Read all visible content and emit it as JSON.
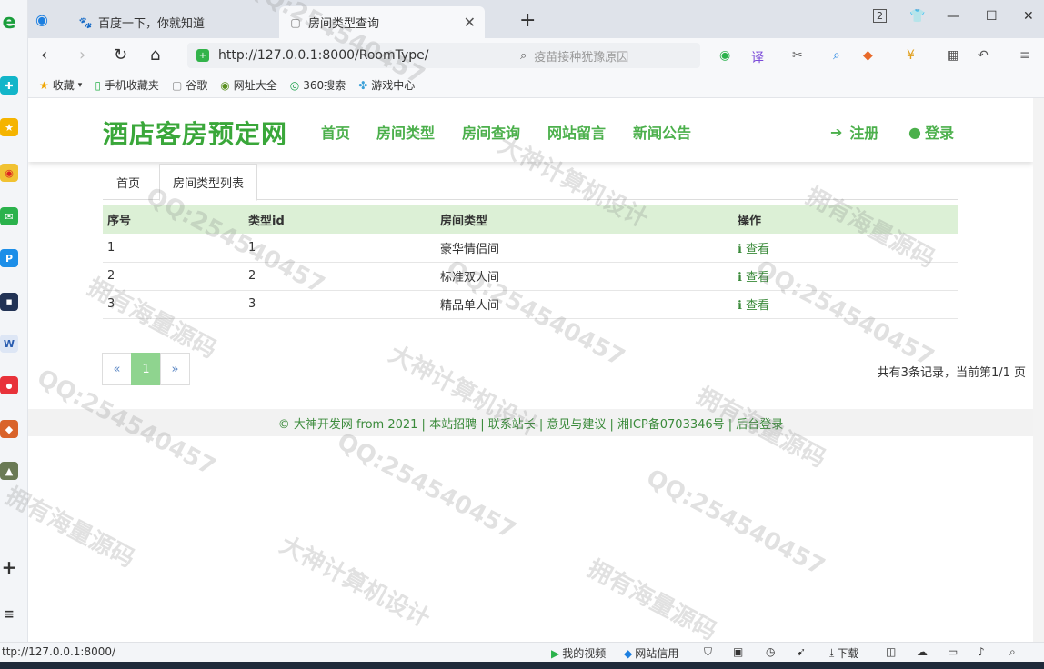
{
  "browser": {
    "tabs": [
      {
        "label": "百度一下，你就知道"
      },
      {
        "label": "房间类型查询"
      }
    ],
    "url": "http://127.0.0.1:8000/RoomType/",
    "search_placeholder": "疫苗接种犹豫原因",
    "bookmarks": [
      "收藏",
      "手机收藏夹",
      "谷歌",
      "网址大全",
      "360搜索",
      "游戏中心"
    ],
    "tab_count": "2",
    "status_url": "ttp://127.0.0.1:8000/",
    "status_items": [
      "我的视频",
      "网站信用",
      "下载"
    ]
  },
  "site": {
    "logo": "酒店客房预定网",
    "menu": [
      "首页",
      "房间类型",
      "房间查询",
      "网站留言",
      "新闻公告"
    ],
    "register": "注册",
    "login": "登录"
  },
  "breadcrumbs": [
    "首页",
    "房间类型列表"
  ],
  "table": {
    "headers": [
      "序号",
      "类型id",
      "房间类型",
      "操作"
    ],
    "rows": [
      {
        "no": "1",
        "id": "1",
        "type": "豪华情侣间",
        "action": "查看"
      },
      {
        "no": "2",
        "id": "2",
        "type": "标准双人间",
        "action": "查看"
      },
      {
        "no": "3",
        "id": "3",
        "type": "精品单人间",
        "action": "查看"
      }
    ]
  },
  "pagination": {
    "prev": "«",
    "current": "1",
    "next": "»",
    "summary": "共有3条记录，当前第1/1 页"
  },
  "footer": "© 大神开发网 from 2021 | 本站招聘 | 联系站长 | 意见与建议 | 湘ICP备0703346号 | 后台登录",
  "watermarks": [
    "QQ:254540457",
    "大神计算机设计",
    "拥有海量源码"
  ]
}
